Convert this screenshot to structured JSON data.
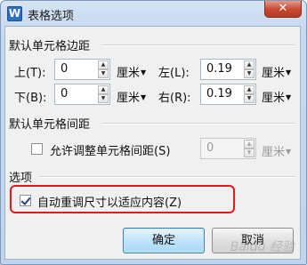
{
  "window": {
    "title": "表格选项",
    "app_icon": "W",
    "close": "✕"
  },
  "margins_group": {
    "label": "默认单元格边距",
    "top": {
      "label": "上(T):",
      "value": "0",
      "unit": "厘米"
    },
    "left": {
      "label": "左(L):",
      "value": "0.19",
      "unit": "厘米"
    },
    "bottom": {
      "label": "下(B):",
      "value": "0",
      "unit": "厘米"
    },
    "right": {
      "label": "右(R):",
      "value": "0.19",
      "unit": "厘米"
    }
  },
  "spacing_group": {
    "label": "默认单元格间距",
    "allow_spacing": {
      "label": "允许调整单元格间距(S)",
      "checked": false
    },
    "spacing": {
      "value": "0",
      "unit": "厘米",
      "disabled": true
    }
  },
  "options_group": {
    "label": "选项",
    "auto_resize": {
      "label": "自动重调尺寸以适应内容(Z)",
      "checked": true
    }
  },
  "buttons": {
    "ok": "确定",
    "cancel": "取消"
  },
  "watermark": "Baidu 经验",
  "colors": {
    "highlight": "#e21b1b",
    "ok_button": "#bfe3f8"
  }
}
